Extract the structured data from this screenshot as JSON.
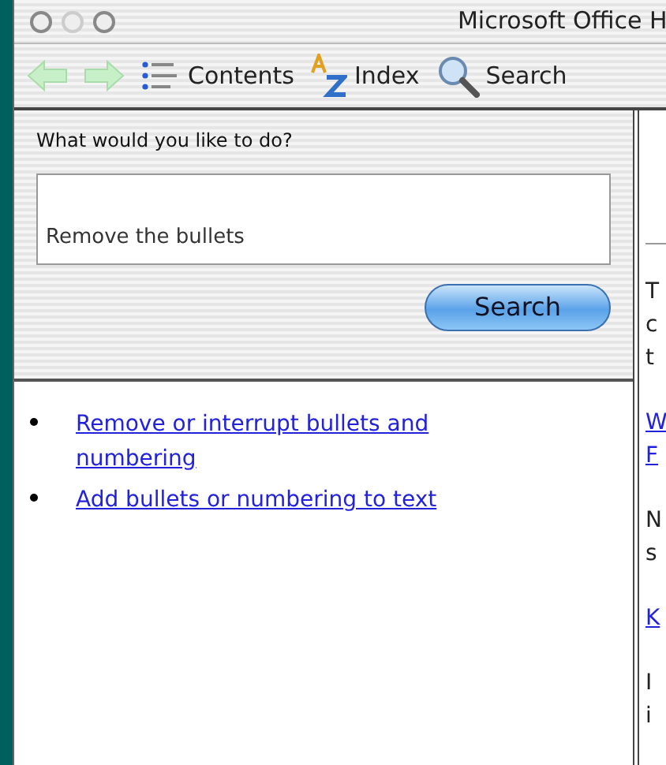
{
  "window": {
    "title": "Microsoft Office H"
  },
  "toolbar": [
    {
      "kind": "back"
    },
    {
      "kind": "forward"
    },
    {
      "kind": "contents",
      "label": "Contents"
    },
    {
      "kind": "index",
      "label": "Index"
    },
    {
      "kind": "search",
      "label": "Search"
    }
  ],
  "question": {
    "label": "What would you like to do?",
    "value": "Remove the bullets",
    "button": "Search"
  },
  "results": [
    "Remove or interrupt bullets and numbering",
    "Add bullets or numbering to text"
  ],
  "right_pane": {
    "blocks": [
      {
        "kind": "text",
        "lines": [
          "T",
          "c",
          "t"
        ]
      },
      {
        "kind": "link",
        "lines": [
          "W",
          "F"
        ]
      },
      {
        "kind": "text",
        "lines": [
          "N",
          "s"
        ]
      },
      {
        "kind": "link",
        "lines": [
          "K"
        ]
      },
      {
        "kind": "text",
        "lines": [
          "I",
          "i"
        ]
      }
    ]
  }
}
